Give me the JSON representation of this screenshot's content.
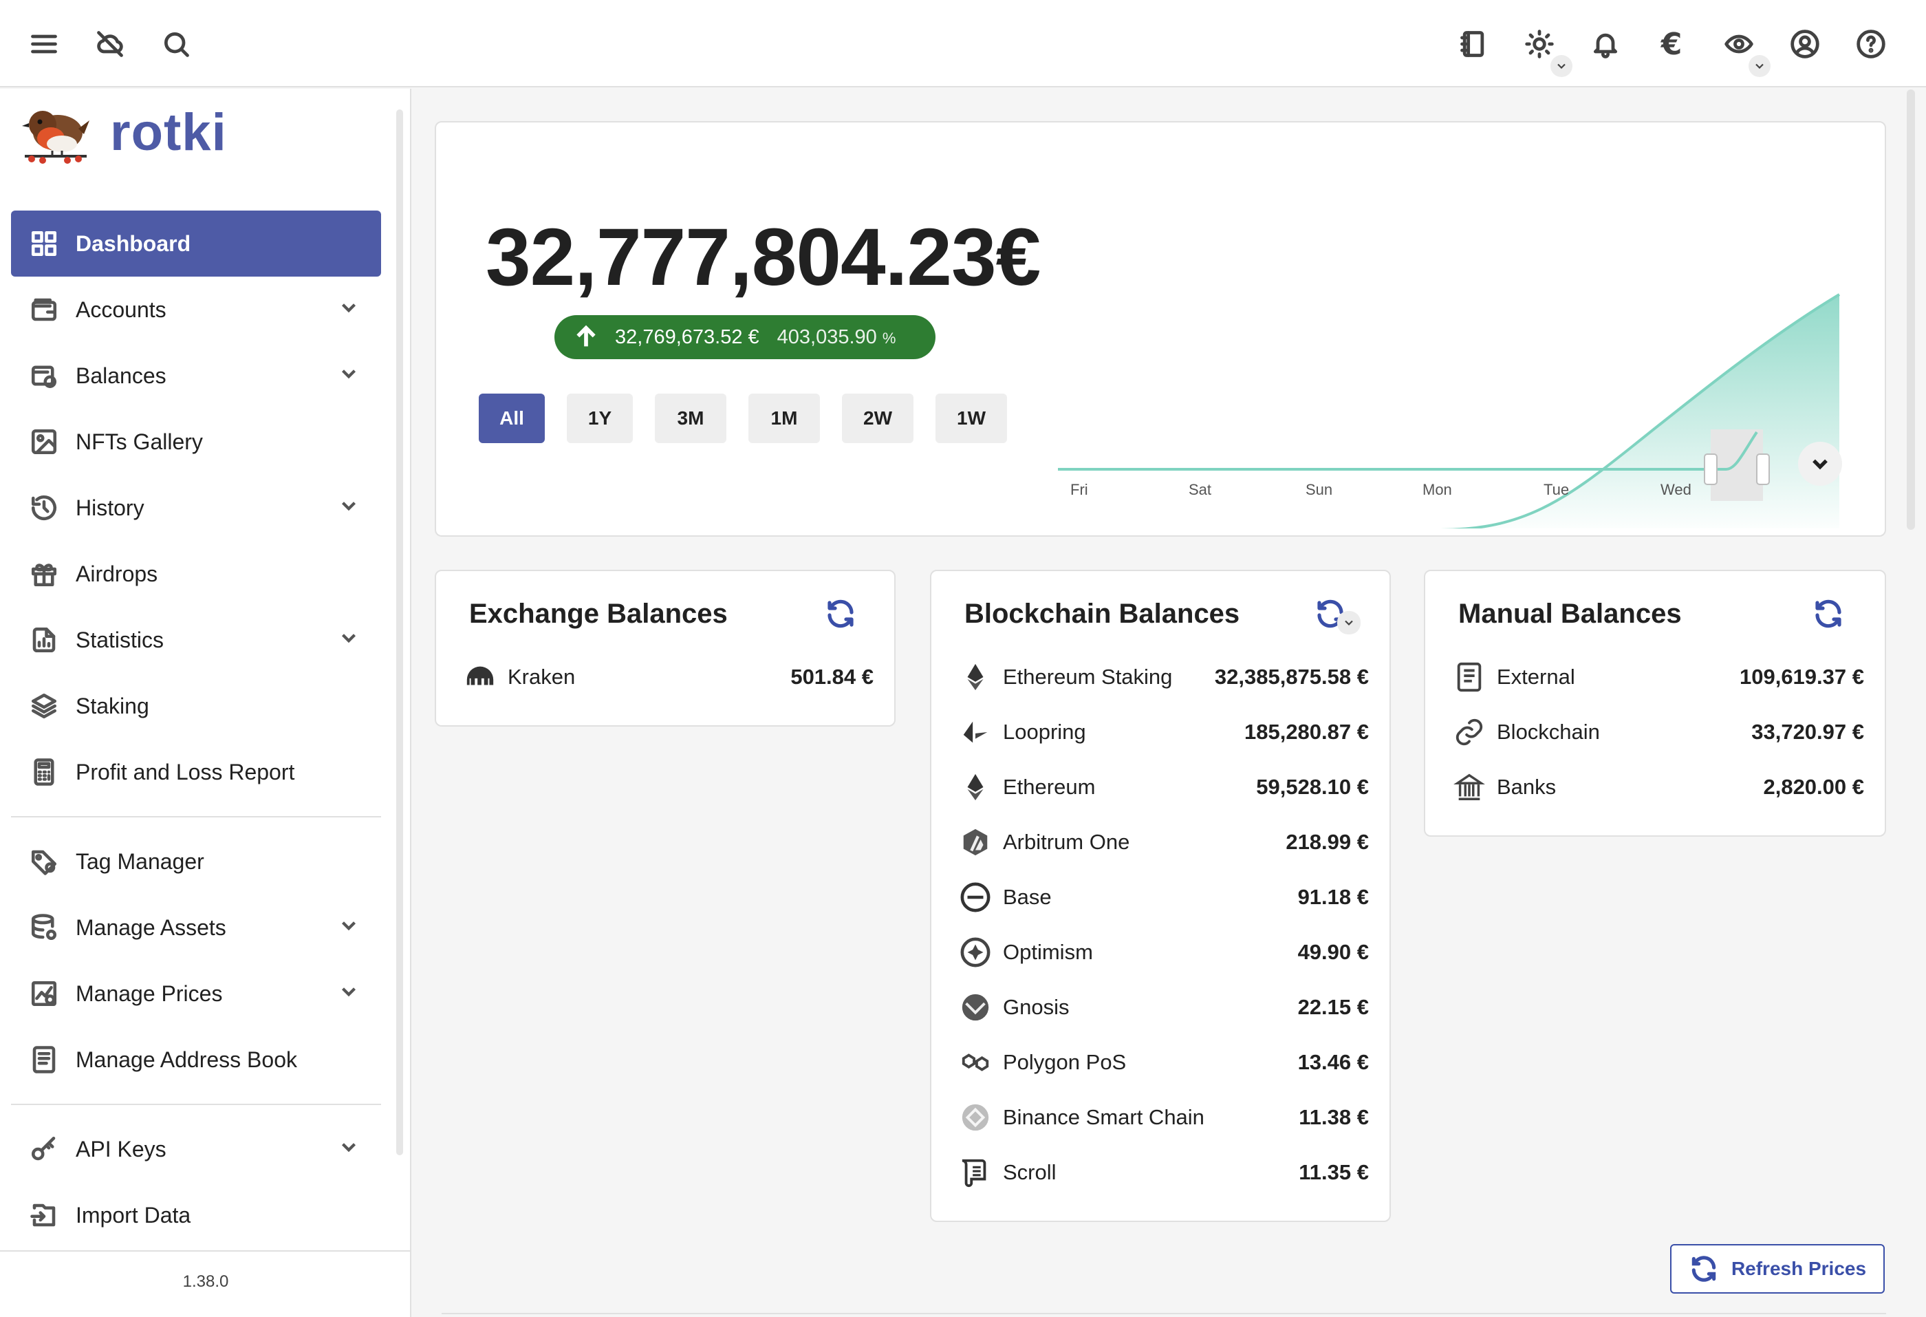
{
  "app": {
    "brand": "rotki",
    "version": "1.38.0"
  },
  "topbar": {
    "left_icons": [
      "menu-icon",
      "cloud-off-icon",
      "search-icon"
    ],
    "right_icons": [
      "notes-icon",
      "theme-icon",
      "bell-icon",
      "currency-icon",
      "privacy-icon",
      "account-icon",
      "help-icon"
    ],
    "currency_symbol": "€"
  },
  "sidebar": {
    "items": [
      {
        "label": "Dashboard",
        "icon": "dashboard-icon",
        "active": true,
        "expandable": false
      },
      {
        "label": "Accounts",
        "icon": "wallet-icon",
        "expandable": true
      },
      {
        "label": "Balances",
        "icon": "balances-icon",
        "expandable": true
      },
      {
        "label": "NFTs Gallery",
        "icon": "image-icon",
        "expandable": false
      },
      {
        "label": "History",
        "icon": "history-icon",
        "expandable": true
      },
      {
        "label": "Airdrops",
        "icon": "gift-icon",
        "expandable": false
      },
      {
        "label": "Statistics",
        "icon": "statistics-icon",
        "expandable": true
      },
      {
        "label": "Staking",
        "icon": "layers-icon",
        "expandable": false
      },
      {
        "label": "Profit and Loss Report",
        "icon": "calculator-icon",
        "expandable": false
      },
      {
        "label": "Tag Manager",
        "icon": "tag-icon",
        "expandable": false
      },
      {
        "label": "Manage Assets",
        "icon": "database-icon",
        "expandable": true
      },
      {
        "label": "Manage Prices",
        "icon": "price-chart-icon",
        "expandable": true
      },
      {
        "label": "Manage Address Book",
        "icon": "address-book-icon",
        "expandable": false
      },
      {
        "label": "API Keys",
        "icon": "key-icon",
        "expandable": true
      },
      {
        "label": "Import Data",
        "icon": "import-icon",
        "expandable": false
      }
    ]
  },
  "overview": {
    "total": "32,777,804.23",
    "currency": "€",
    "change_amount": "32,769,673.52 €",
    "change_percent": "403,035.90",
    "percent_sign": "%",
    "ranges": [
      "All",
      "1Y",
      "3M",
      "1M",
      "2W",
      "1W"
    ],
    "active_range": "All",
    "mini_axis_labels": [
      "Fri",
      "Sat",
      "Sun",
      "Mon",
      "Tue",
      "Wed"
    ],
    "accent_color": "#7fd3c0"
  },
  "exchange_balances": {
    "title": "Exchange Balances",
    "rows": [
      {
        "name": "Kraken",
        "value": "501.84 €",
        "icon": "kraken-icon"
      }
    ]
  },
  "blockchain_balances": {
    "title": "Blockchain Balances",
    "rows": [
      {
        "name": "Ethereum Staking",
        "value": "32,385,875.58 €",
        "icon": "ethereum-icon"
      },
      {
        "name": "Loopring",
        "value": "185,280.87 €",
        "icon": "loopring-icon"
      },
      {
        "name": "Ethereum",
        "value": "59,528.10 €",
        "icon": "ethereum-icon"
      },
      {
        "name": "Arbitrum One",
        "value": "218.99 €",
        "icon": "arbitrum-icon"
      },
      {
        "name": "Base",
        "value": "91.18 €",
        "icon": "base-icon"
      },
      {
        "name": "Optimism",
        "value": "49.90 €",
        "icon": "optimism-icon"
      },
      {
        "name": "Gnosis",
        "value": "22.15 €",
        "icon": "gnosis-icon"
      },
      {
        "name": "Polygon PoS",
        "value": "13.46 €",
        "icon": "polygon-icon"
      },
      {
        "name": "Binance Smart Chain",
        "value": "11.38 €",
        "icon": "bsc-icon"
      },
      {
        "name": "Scroll",
        "value": "11.35 €",
        "icon": "scroll-icon"
      }
    ]
  },
  "manual_balances": {
    "title": "Manual Balances",
    "rows": [
      {
        "name": "External",
        "value": "109,619.37 €",
        "icon": "document-icon"
      },
      {
        "name": "Blockchain",
        "value": "33,720.97 €",
        "icon": "link-icon"
      },
      {
        "name": "Banks",
        "value": "2,820.00 €",
        "icon": "bank-icon"
      }
    ]
  },
  "refresh_prices_label": "Refresh Prices",
  "colors": {
    "primary": "#4e5ba6",
    "link": "#3a4fa8",
    "positive": "#2e7d32"
  }
}
